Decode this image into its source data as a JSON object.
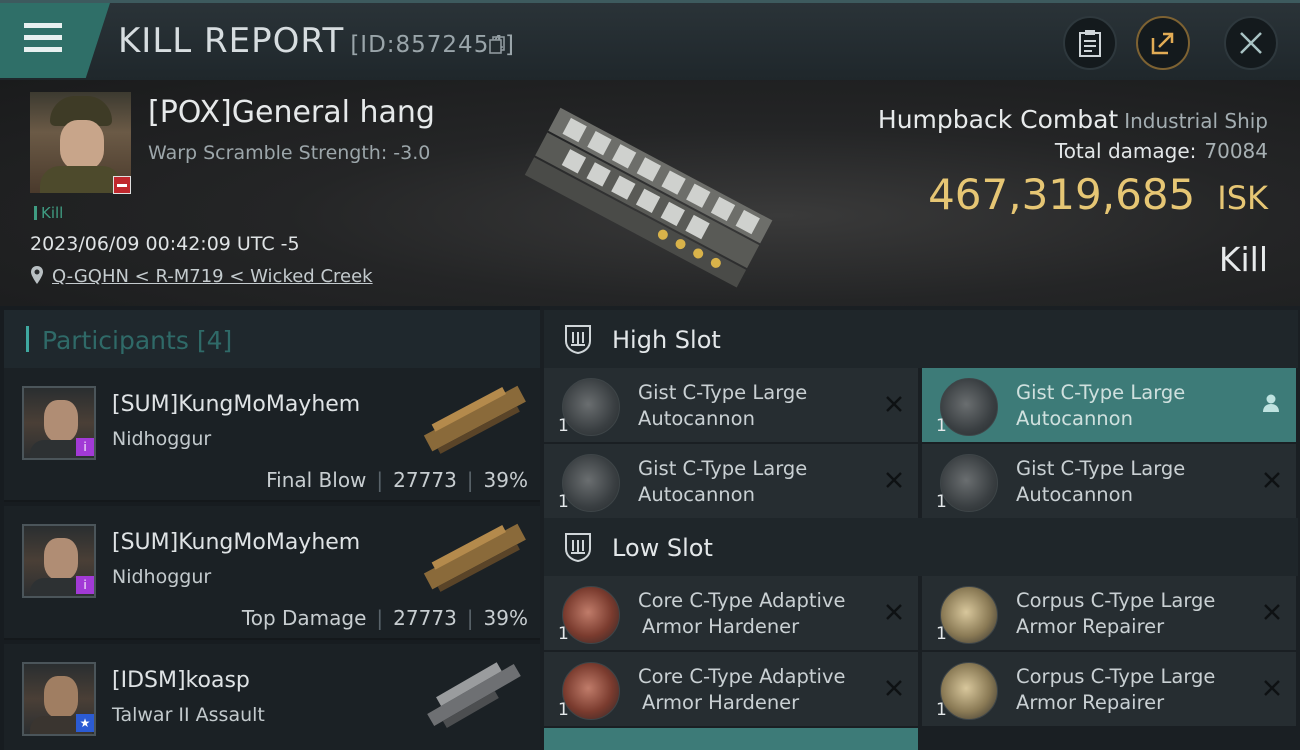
{
  "header": {
    "title": "KILL REPORT",
    "report_id": "[ID:8572454]",
    "icons": {
      "menu": "menu-icon",
      "copy": "copy-icon",
      "clipboard": "clipboard-icon",
      "share": "share-icon",
      "close": "close-icon"
    }
  },
  "victim": {
    "name": "[POX]General hang",
    "warp_scramble": "Warp Scramble Strength: -3.0",
    "status_tag": "Kill",
    "timestamp": "2023/06/09 00:42:09 UTC -5",
    "location": "Q-GQHN < R-M719 < Wicked Creek",
    "ship_name": "Humpback Combat",
    "ship_class": "Industrial Ship",
    "total_damage_label": "Total damage:",
    "total_damage": "70084",
    "isk_value": "467,319,685",
    "isk_unit": "ISK",
    "result": "Kill"
  },
  "participants": {
    "label": "Participants",
    "count": "[4]",
    "rows": [
      {
        "name": "[SUM]KungMoMayhem",
        "ship": "Nidhoggur",
        "tag": "Final Blow",
        "damage": "27773",
        "percent": "39%",
        "badge_color": "#a23ad6"
      },
      {
        "name": "[SUM]KungMoMayhem",
        "ship": "Nidhoggur",
        "tag": "Top Damage",
        "damage": "27773",
        "percent": "39%",
        "badge_color": "#a23ad6"
      },
      {
        "name": "[IDSM]koasp",
        "ship": "Talwar II Assault",
        "badge_color": "#2b5bd3"
      }
    ]
  },
  "fitting": {
    "high_slot": {
      "label": "High Slot",
      "modules": [
        {
          "name_line1": "Gist C-Type Large",
          "name_line2": "Autocannon",
          "qty": "1"
        },
        {
          "name_line1": "Gist C-Type Large",
          "name_line2": "Autocannon",
          "qty": "1"
        },
        {
          "name_line1": "Gist C-Type Large",
          "name_line2": "Autocannon",
          "qty": "1"
        },
        {
          "name_line1": "Gist C-Type Large",
          "name_line2": "Autocannon",
          "qty": "1"
        }
      ]
    },
    "low_slot": {
      "label": "Low Slot",
      "modules": [
        {
          "name_line1": "Core C-Type Adaptive",
          "name_line2": "Armor Hardener",
          "qty": "1"
        },
        {
          "name_line1": "Corpus C-Type Large",
          "name_line2": "Armor Repairer",
          "qty": "1"
        },
        {
          "name_line1": "Core C-Type Adaptive",
          "name_line2": "Armor Hardener",
          "qty": "1"
        },
        {
          "name_line1": "Corpus C-Type Large",
          "name_line2": "Armor Repairer",
          "qty": "1"
        }
      ]
    }
  },
  "colors": {
    "accent": "#3f9c82",
    "isk": "#e6c674",
    "highlight": "#3d7b78",
    "status_minus": "#c0282d"
  }
}
